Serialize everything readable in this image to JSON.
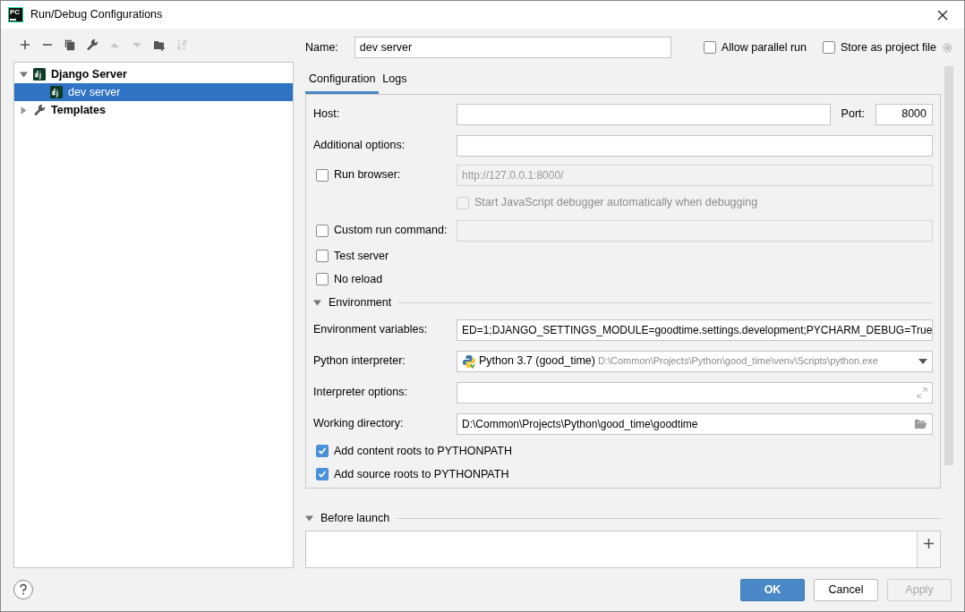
{
  "window": {
    "logo": "PC",
    "title": "Run/Debug Configurations"
  },
  "toolbar": [
    {
      "disabled": false
    },
    {
      "disabled": false
    },
    {
      "disabled": false
    },
    {
      "disabled": false
    },
    {
      "disabled": true
    },
    {
      "disabled": true
    },
    {
      "disabled": false
    },
    {
      "disabled": true
    }
  ],
  "tree": [
    {
      "label": "Django Server",
      "expanded": true,
      "selected": false,
      "children": [
        {
          "label": "dev server",
          "selected": true
        }
      ]
    },
    {
      "label": "Templates",
      "expanded": false,
      "selected": false
    }
  ],
  "name": {
    "label": "Name:",
    "value": "dev server"
  },
  "options": [
    {
      "label": "Allow parallel run",
      "checked": false
    },
    {
      "label": "Store as project file",
      "checked": false
    }
  ],
  "tabs": [
    {
      "label": "Configuration",
      "selected": true
    },
    {
      "label": "Logs",
      "selected": false
    }
  ],
  "host": {
    "label": "Host:",
    "port_label": "Port:",
    "port": "8000"
  },
  "rows": [
    {
      "kind": "field",
      "label": "Additional options:"
    },
    {
      "kind": "checkfield",
      "label": "Run browser:",
      "checked": false,
      "placeholder": "http://127.0.0.1:8000/",
      "disabled": true
    },
    {
      "kind": "subcheck",
      "label": "Start JavaScript debugger automatically when debugging",
      "checked": false,
      "disabled": true
    },
    {
      "kind": "checkfield",
      "label": "Custom run command:",
      "checked": false,
      "disabled": true
    },
    {
      "kind": "check",
      "label": "Test server",
      "checked": false
    },
    {
      "kind": "check",
      "label": "No reload",
      "checked": false
    }
  ],
  "environment": {
    "title": "Environment",
    "expanded": true
  },
  "env_rows": [
    {
      "kind": "field",
      "label": "Environment variables:",
      "value": "ED=1;DJANGO_SETTINGS_MODULE=goodtime.settings.development;PYCHARM_DEBUG=True"
    },
    {
      "kind": "select",
      "label": "Python interpreter:",
      "value": "Python 3.7 (good_time)",
      "detail": "D:\\Common\\Projects\\Python\\good_time\\venv\\Scripts\\python.exe"
    },
    {
      "kind": "field",
      "label": "Interpreter options:"
    },
    {
      "kind": "field",
      "label": "Working directory:",
      "value": "D:\\Common\\Projects\\Python\\good_time\\goodtime"
    },
    {
      "kind": "check",
      "label": "Add content roots to PYTHONPATH",
      "checked": true
    },
    {
      "kind": "check",
      "label": "Add source roots to PYTHONPATH",
      "checked": true
    }
  ],
  "before_launch": {
    "title": "Before launch",
    "expanded": true
  },
  "buttons": [
    {
      "label": "OK",
      "kind": "primary",
      "disabled": false
    },
    {
      "label": "Cancel",
      "kind": "normal",
      "disabled": false
    },
    {
      "label": "Apply",
      "kind": "normal",
      "disabled": true
    }
  ]
}
